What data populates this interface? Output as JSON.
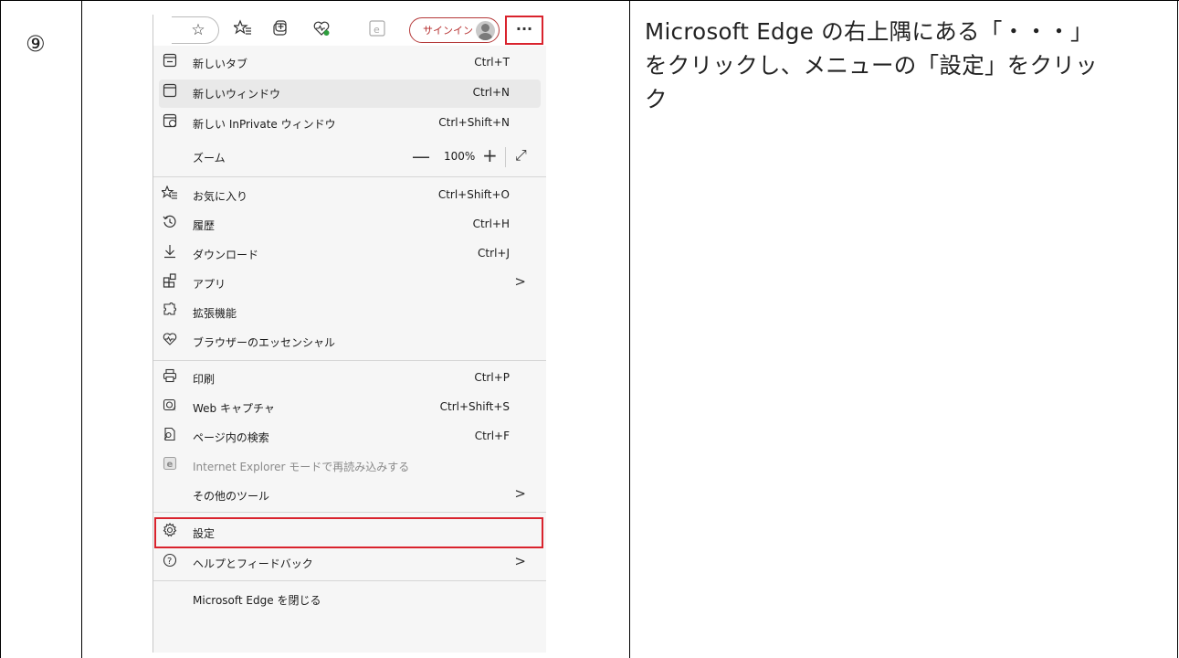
{
  "step": {
    "number": "⑨"
  },
  "description": {
    "line1": "Microsoft Edge の右上隅にある「・・・」",
    "line2": "をクリックし、メニューの「設定」をクリッ",
    "line3": "ク"
  },
  "toolbar": {
    "signin_label": "サインイン",
    "more_label": "···",
    "icons": [
      "favorite-star-icon",
      "favorites-list-icon",
      "collections-icon",
      "browser-essentials-icon",
      "ie-mode-icon"
    ]
  },
  "menu": {
    "new_tab": {
      "label": "新しいタブ",
      "shortcut": "Ctrl+T"
    },
    "new_window": {
      "label": "新しいウィンドウ",
      "shortcut": "Ctrl+N"
    },
    "new_inprivate": {
      "label": "新しい InPrivate ウィンドウ",
      "shortcut": "Ctrl+Shift+N"
    },
    "zoom": {
      "label": "ズーム",
      "minus": "—",
      "value": "100%",
      "plus": "+",
      "fullscreen": "⤢"
    },
    "favorites": {
      "label": "お気に入り",
      "shortcut": "Ctrl+Shift+O"
    },
    "history": {
      "label": "履歴",
      "shortcut": "Ctrl+H"
    },
    "downloads": {
      "label": "ダウンロード",
      "shortcut": "Ctrl+J"
    },
    "apps": {
      "label": "アプリ",
      "arrow": ">"
    },
    "extensions": {
      "label": "拡張機能"
    },
    "essentials": {
      "label": "ブラウザーのエッセンシャル"
    },
    "print": {
      "label": "印刷",
      "shortcut": "Ctrl+P"
    },
    "web_capture": {
      "label": "Web キャプチャ",
      "shortcut": "Ctrl+Shift+S"
    },
    "find": {
      "label": "ページ内の検索",
      "shortcut": "Ctrl+F"
    },
    "ie_mode": {
      "label": "Internet Explorer モードで再読み込みする"
    },
    "more_tools": {
      "label": "その他のツール",
      "arrow": ">"
    },
    "settings": {
      "label": "設定"
    },
    "help": {
      "label": "ヘルプとフィードバック",
      "arrow": ">"
    },
    "close": {
      "label": "Microsoft Edge を閉じる"
    }
  },
  "colors": {
    "highlight": "#d9232d",
    "signin": "#b52e2e"
  }
}
